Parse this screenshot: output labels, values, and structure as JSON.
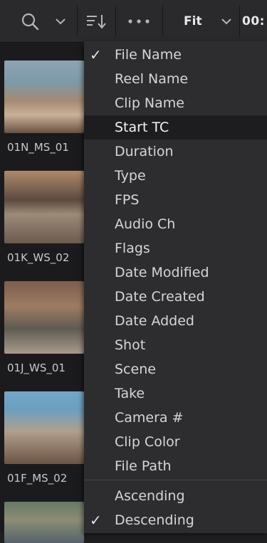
{
  "toolbar": {
    "search_icon": "search-icon",
    "sort_icon": "sort-icon",
    "more_icon": "more-icon",
    "fit_label": "Fit",
    "timecode_partial": "00:"
  },
  "thumbnails": [
    {
      "label": "01N_MS_01"
    },
    {
      "label": "01K_WS_02"
    },
    {
      "label": "01J_WS_01"
    },
    {
      "label": "01F_MS_02"
    },
    {
      "label": ""
    }
  ],
  "sort_menu": {
    "fields": [
      {
        "label": "File Name",
        "checked": true
      },
      {
        "label": "Reel Name",
        "checked": false
      },
      {
        "label": "Clip Name",
        "checked": false
      },
      {
        "label": "Start TC",
        "checked": false,
        "highlighted": true
      },
      {
        "label": "Duration",
        "checked": false
      },
      {
        "label": "Type",
        "checked": false
      },
      {
        "label": "FPS",
        "checked": false
      },
      {
        "label": "Audio Ch",
        "checked": false
      },
      {
        "label": "Flags",
        "checked": false
      },
      {
        "label": "Date Modified",
        "checked": false
      },
      {
        "label": "Date Created",
        "checked": false
      },
      {
        "label": "Date Added",
        "checked": false
      },
      {
        "label": "Shot",
        "checked": false
      },
      {
        "label": "Scene",
        "checked": false
      },
      {
        "label": "Take",
        "checked": false
      },
      {
        "label": "Camera #",
        "checked": false
      },
      {
        "label": "Clip Color",
        "checked": false
      },
      {
        "label": "File Path",
        "checked": false
      }
    ],
    "order": [
      {
        "label": "Ascending",
        "checked": false
      },
      {
        "label": "Descending",
        "checked": true
      }
    ],
    "checkmark": "✓"
  },
  "colors": {
    "toolbar_bg": "#2a2a2d",
    "menu_bg": "#2d2d30",
    "menu_highlight": "#1d1d1f",
    "text": "#d6d6d9"
  }
}
